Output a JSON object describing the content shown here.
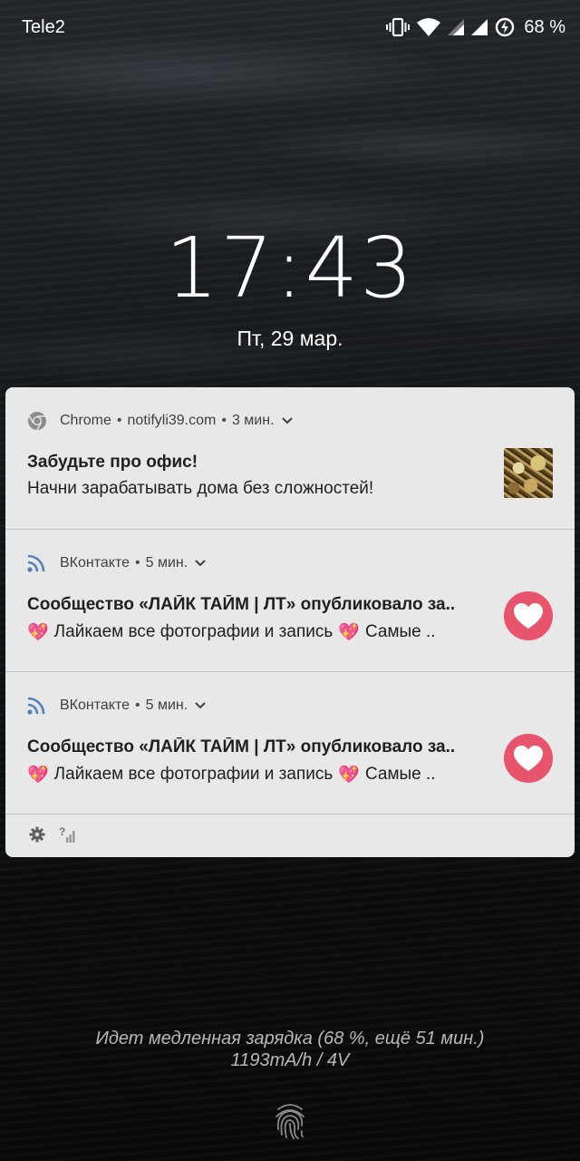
{
  "status_bar": {
    "carrier": "Tele2",
    "battery_percent": "68 %",
    "icons": [
      "vibrate-icon",
      "wifi-icon",
      "signal-icon",
      "signal-icon",
      "battery-saver-icon"
    ]
  },
  "lockscreen": {
    "time": "17:43",
    "date": "Пт, 29 мар."
  },
  "notifications": [
    {
      "app": "Chrome",
      "source": "notifyli39.com",
      "time": "3 мин.",
      "title": "Забудьте про офис!",
      "text": "Начни зарабатывать дома без сложностей!",
      "icon": "chrome-icon",
      "thumbnail": "money-thumbnail"
    },
    {
      "app": "ВКонтакте",
      "time": "5 мин.",
      "title": "Сообщество «ЛАЙК ТАЙМ | ЛТ» опубликовало за..",
      "text_part1": "Лайкаем все фотографии и запись",
      "text_part2": "Самые ..",
      "emoji": "💖",
      "icon": "rss-icon",
      "thumbnail": "heart-icon"
    },
    {
      "app": "ВКонтакте",
      "time": "5 мин.",
      "title": "Сообщество «ЛАЙК ТАЙМ | ЛТ» опубликовало за..",
      "text_part1": "Лайкаем все фотографии и запись",
      "text_part2": "Самые ..",
      "emoji": "💖",
      "icon": "rss-icon",
      "thumbnail": "heart-icon"
    }
  ],
  "footer_icons": [
    "gear-icon",
    "no-sim-icon"
  ],
  "charging": {
    "line1": "Идет медленная зарядка (68 %, ещё 51 мин.)",
    "line2": "1193mA/h / 4V"
  },
  "colors": {
    "panel_bg": "#e8e8e8",
    "heart_bg": "#e8546c",
    "vk_icon": "#5181b8"
  }
}
